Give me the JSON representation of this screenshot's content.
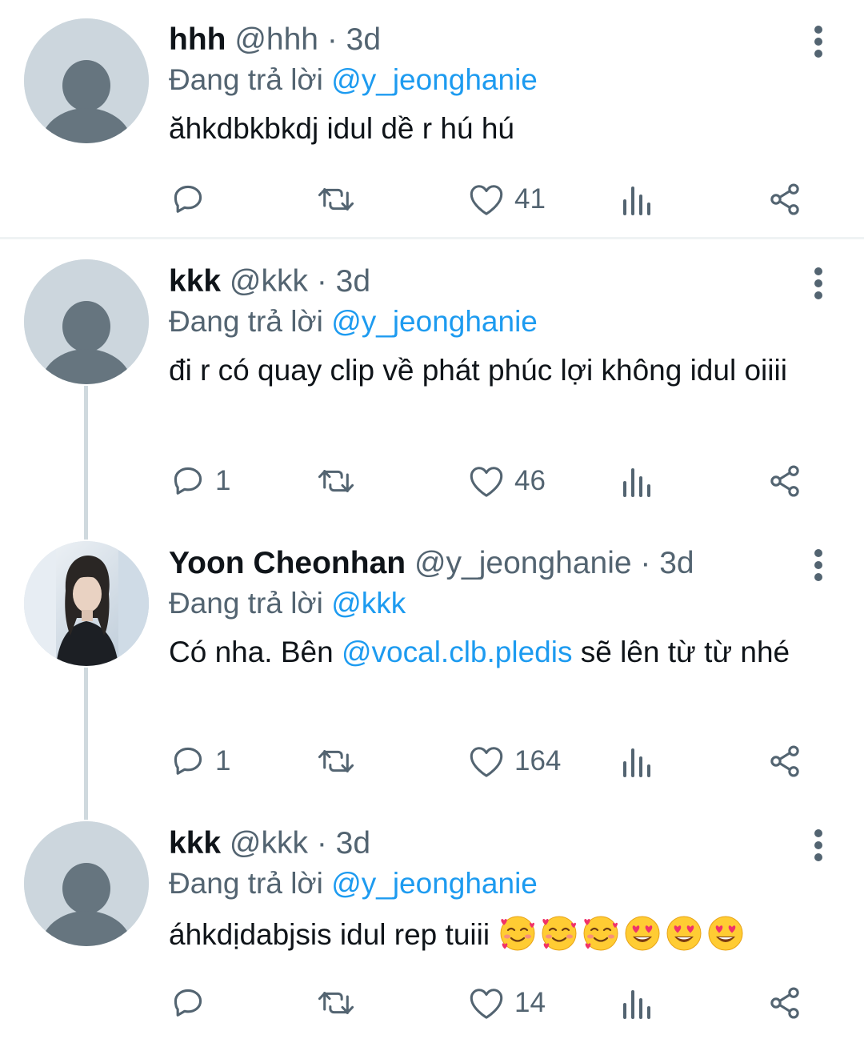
{
  "tweets": [
    {
      "name": "hhh",
      "handle": "@hhh",
      "time": "· 3d",
      "replying_prefix": "Đang trả lời ",
      "replying_to": "@y_jeonghanie",
      "text": "ăhkdbkbkdj idul dề r hú hú",
      "reply_count": "",
      "like_count": "41",
      "avatar": "default-avatar"
    },
    {
      "name": "kkk",
      "handle": "@kkk",
      "time": "· 3d",
      "replying_prefix": "Đang trả lời ",
      "replying_to": "@y_jeonghanie",
      "text": "đi r có quay clip về phát phúc lợi không idul oiiii",
      "reply_count": "1",
      "like_count": "46",
      "avatar": "default-avatar"
    },
    {
      "name": "Yoon Cheonhan",
      "handle": "@y_jeonghanie",
      "time": "· 3d",
      "replying_prefix": "Đang trả lời ",
      "replying_to": "@kkk",
      "text_before": "Có nha. Bên ",
      "text_mention": "@vocal.clb.pledis",
      "text_after": " sẽ lên từ từ nhé",
      "reply_count": "1",
      "like_count": "164",
      "avatar": "photo-avatar"
    },
    {
      "name": "kkk",
      "handle": "@kkk",
      "time": "· 3d",
      "replying_prefix": "Đang trả lời ",
      "replying_to": "@y_jeonghanie",
      "text": "áhkdịdabjsis idul rep tuiii",
      "emojis": [
        "smiling-face-with-hearts",
        "smiling-face-with-hearts",
        "smiling-face-with-hearts",
        "heart-eyes",
        "heart-eyes",
        "heart-eyes"
      ],
      "reply_count": "",
      "like_count": "14",
      "avatar": "default-avatar"
    }
  ],
  "colors": {
    "link": "#1d9bf0",
    "secondary_text": "#536471",
    "primary_text": "#0f1419",
    "thread_line": "#cfd9de",
    "avatar_bg": "#ccd6dd",
    "avatar_figure": "#66757f"
  }
}
